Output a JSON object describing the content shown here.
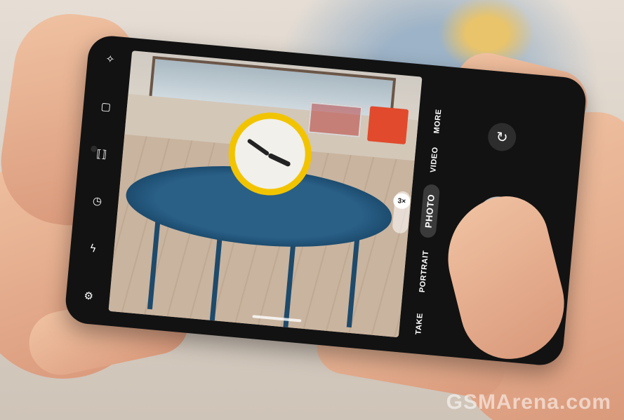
{
  "camera": {
    "zoom_label": "3×",
    "modes": [
      "TAKE",
      "PORTRAIT",
      "PHOTO",
      "VIDEO",
      "MORE"
    ],
    "active_mode": "PHOTO",
    "left_toolbar_icons": [
      "magic-wand-icon",
      "motion-photo-icon",
      "aspect-ratio-icon",
      "timer-icon",
      "flash-off-icon",
      "settings-icon"
    ]
  },
  "watermark": "GSMArena.com",
  "colors": {
    "clock_rim": "#f2c400",
    "table": "#2a5f86",
    "box": "#e14a2c"
  }
}
